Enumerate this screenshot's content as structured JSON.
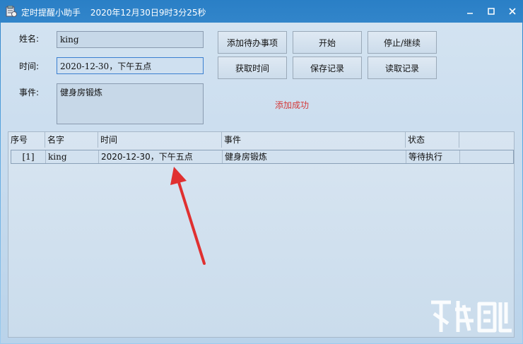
{
  "window": {
    "title": "定时提醒小助手",
    "datetime": "2020年12月30日9时3分25秒",
    "icons": {
      "app": "app-icon",
      "minimize": "minimize-icon",
      "maximize": "maximize-icon",
      "close": "close-icon"
    }
  },
  "form": {
    "name_label": "姓名:",
    "name_value": "king",
    "time_label": "时间:",
    "time_value": "2020-12-30，下午五点",
    "event_label": "事件:",
    "event_value": "健身房锻炼"
  },
  "buttons": {
    "add_todo": "添加待办事项",
    "start": "开始",
    "stop_continue": "停止/继续",
    "get_time": "获取时间",
    "save_record": "保存记录",
    "read_record": "读取记录"
  },
  "status_message": "添加成功",
  "status_color": "#d43a3a",
  "table": {
    "columns": [
      "序号",
      "名字",
      "时间",
      "事件",
      "状态"
    ],
    "rows": [
      [
        "[1]",
        "king",
        "2020-12-30，下午五点",
        "健身房锻炼",
        "等待执行"
      ]
    ]
  },
  "annotation": {
    "arrow_color": "#e03030"
  }
}
